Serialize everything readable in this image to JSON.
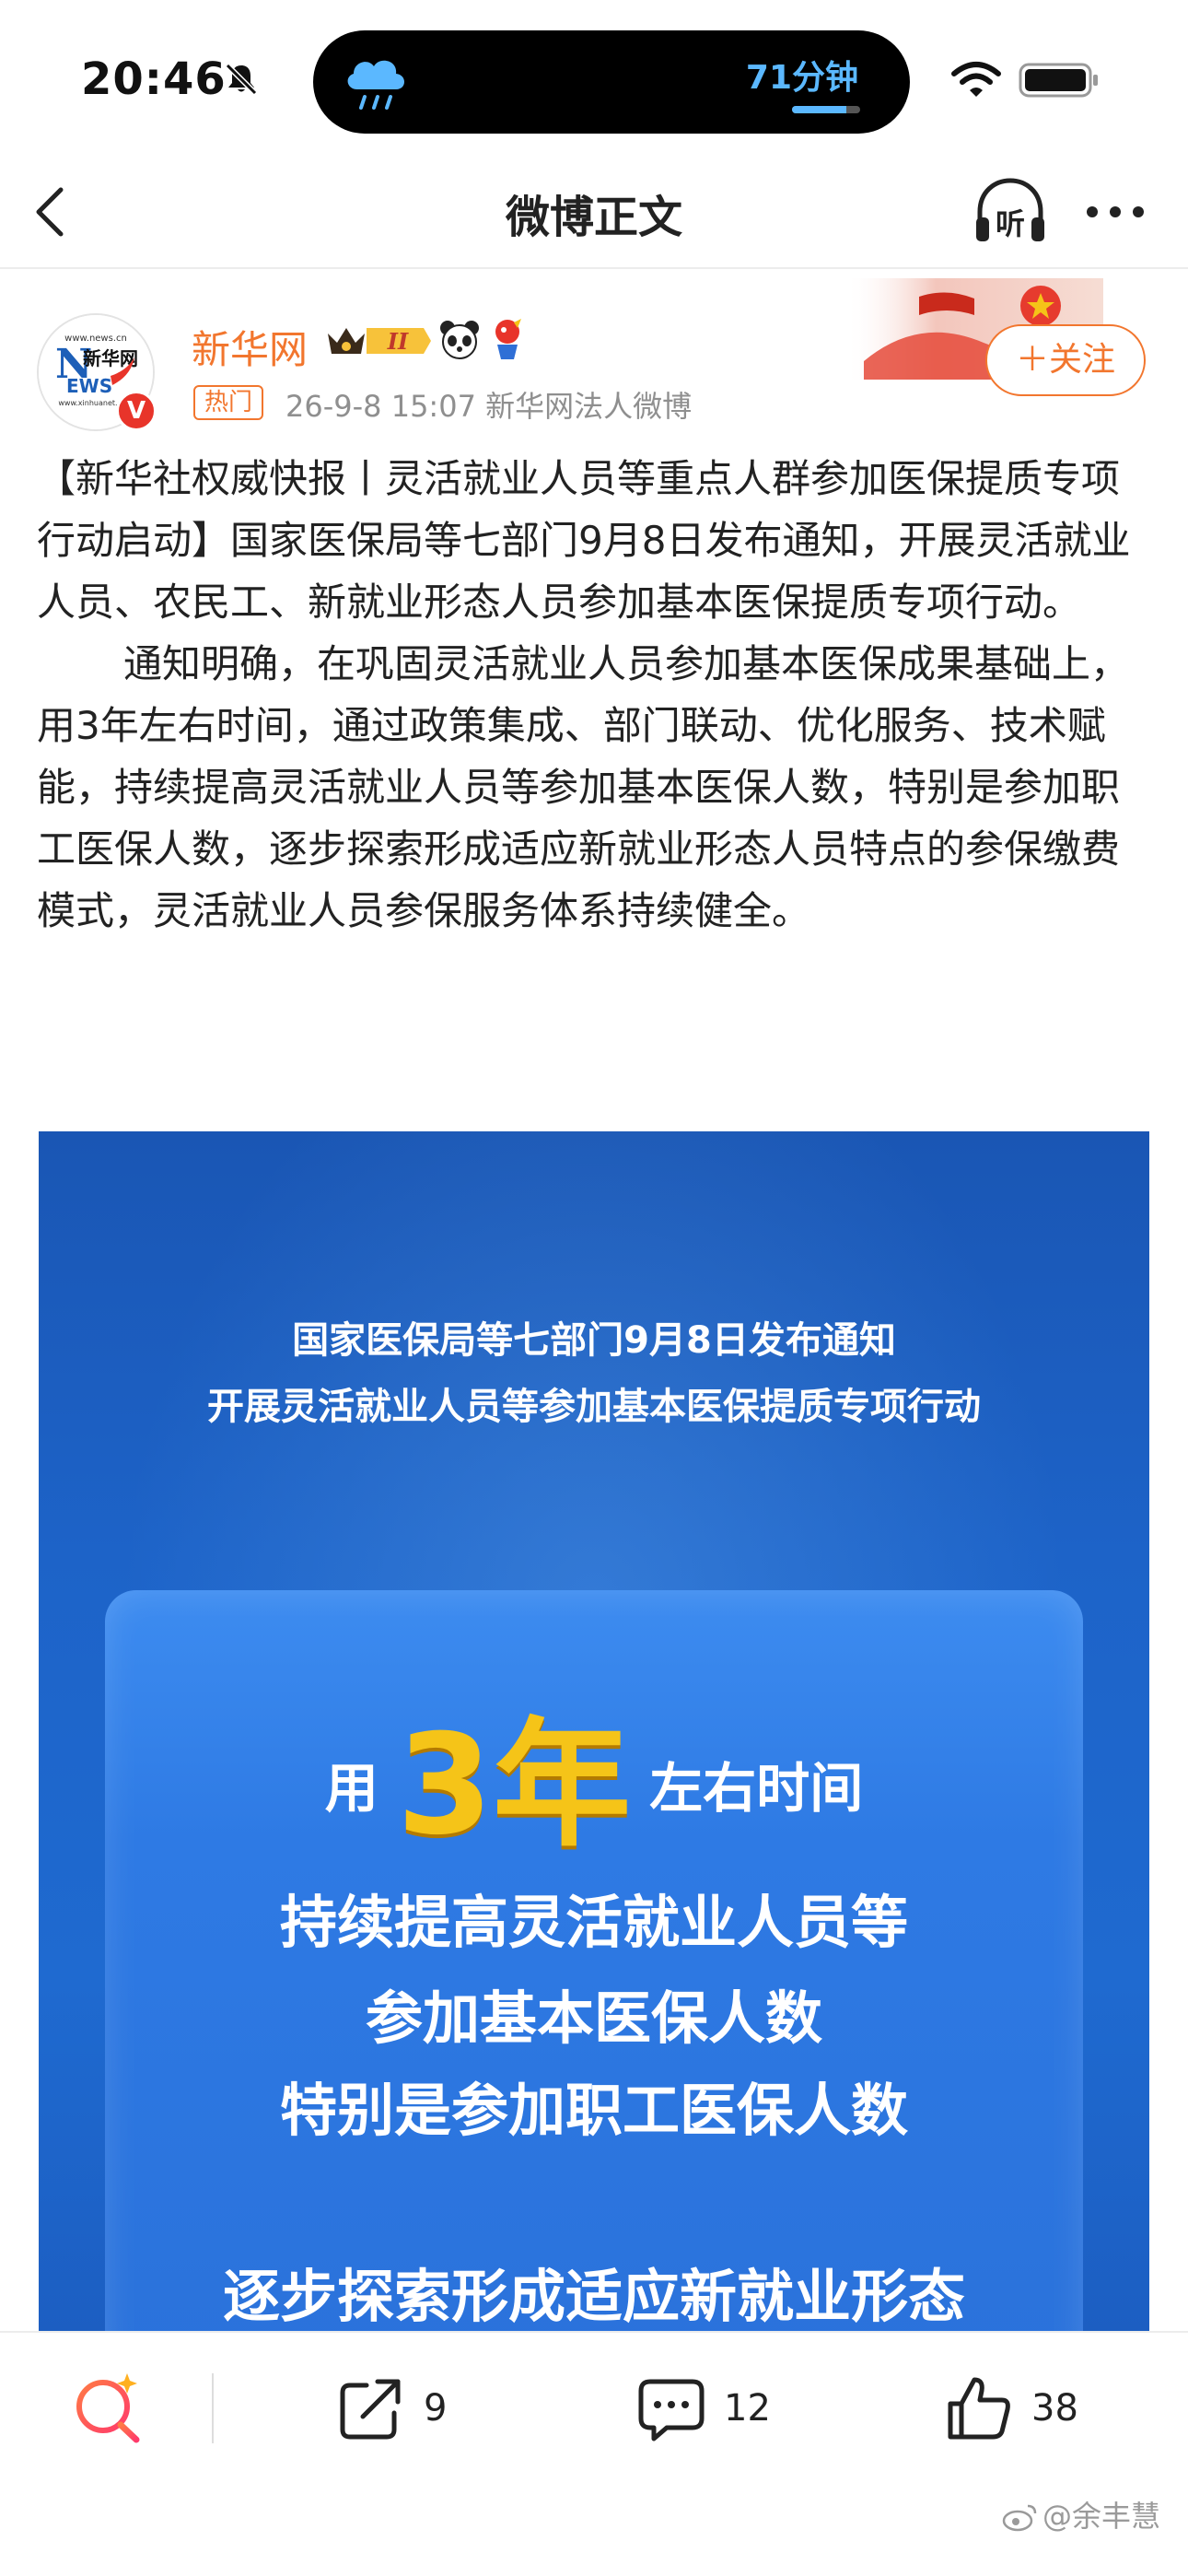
{
  "status_bar": {
    "time": "20:46",
    "island_text": "71分钟",
    "island_progress": 0.8
  },
  "nav": {
    "title": "微博正文",
    "listen_label": "听"
  },
  "author": {
    "name": "新华网",
    "badge_level": "II",
    "hot_tag": "热门",
    "meta": "26-9-8 15:07  新华网法人微博",
    "follow_label": "＋关注",
    "avatar_text": {
      "site": "www.news.cn",
      "n_letters": "N",
      "brand": "新华网",
      "ews": "EWS",
      "domain": "www.xinhuanet.com",
      "verified": "V"
    }
  },
  "post": {
    "paragraph1": "【新华社权威快报丨灵活就业人员等重点人群参加医保提质专项行动启动】国家医保局等七部门9月8日发布通知，开展灵活就业人员、农民工、新就业形态人员参加基本医保提质专项行动。",
    "paragraph2": "通知明确，在巩固灵活就业人员参加基本医保成果基础上，用3年左右时间，通过政策集成、部门联动、优化服务、技术赋能，持续提高灵活就业人员等参加基本医保人数，特别是参加职工医保人数，逐步探索形成适应新就业形态人员特点的参保缴费模式，灵活就业人员参保服务体系持续健全。"
  },
  "image": {
    "line1": "国家医保局等七部门9月8日发布通知",
    "line2": "开展灵活就业人员等参加基本医保提质专项行动",
    "years_prefix": "用",
    "years_number": "3年",
    "years_suffix": "左右时间",
    "panel_line1": "持续提高灵活就业人员等",
    "panel_line2": "参加基本医保人数",
    "panel_line3": "特别是参加职工医保人数",
    "panel_line4": "逐步探索形成适应新就业形态"
  },
  "bottom_bar": {
    "share_count": "9",
    "comment_count": "12",
    "like_count": "38",
    "watermark": "@余丰慧"
  },
  "colors": {
    "accent_orange": "#f2762e",
    "image_blue": "#1d63c8",
    "highlight_yellow": "#f5c418"
  }
}
